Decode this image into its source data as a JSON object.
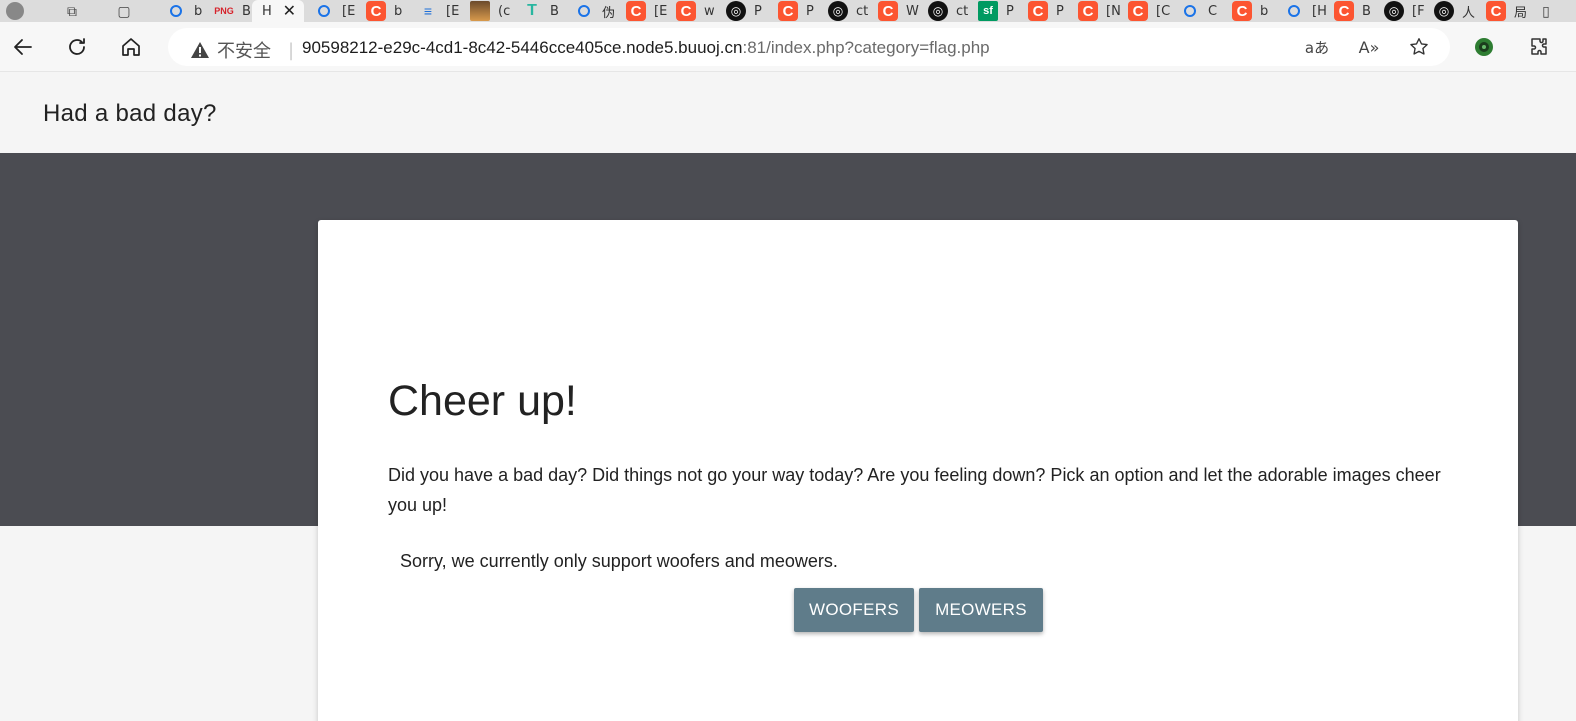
{
  "browser": {
    "tabs": [
      {
        "label": "bu",
        "icon": "search-icon"
      },
      {
        "label": "B",
        "icon": "page-icon"
      },
      {
        "label": "H",
        "icon": "page-icon",
        "active": true
      },
      {
        "label": "[E",
        "icon": "search-icon"
      },
      {
        "label": "b",
        "icon": "csdn-icon"
      },
      {
        "label": "[E",
        "icon": "layers-icon"
      },
      {
        "label": "(c",
        "icon": "image-icon"
      },
      {
        "label": "B",
        "icon": "t-icon"
      },
      {
        "label": "伪",
        "icon": "search-icon"
      },
      {
        "label": "[E",
        "icon": "csdn-icon"
      },
      {
        "label": "w",
        "icon": "csdn-icon"
      },
      {
        "label": "P",
        "icon": "spiral-icon"
      },
      {
        "label": "P",
        "icon": "csdn-icon"
      },
      {
        "label": "ct",
        "icon": "spiral-icon"
      },
      {
        "label": "W",
        "icon": "csdn-icon"
      },
      {
        "label": "ct",
        "icon": "spiral-icon"
      },
      {
        "label": "P",
        "icon": "sf-icon"
      },
      {
        "label": "P",
        "icon": "csdn-icon"
      },
      {
        "label": "[N",
        "icon": "csdn-icon"
      },
      {
        "label": "[C",
        "icon": "csdn-icon"
      },
      {
        "label": "C",
        "icon": "search-icon"
      },
      {
        "label": "b",
        "icon": "csdn-icon"
      },
      {
        "label": "[H",
        "icon": "search-icon"
      },
      {
        "label": "B",
        "icon": "csdn-icon"
      },
      {
        "label": "[F",
        "icon": "spiral-icon"
      },
      {
        "label": "人",
        "icon": "spiral-icon"
      },
      {
        "label": "局",
        "icon": "csdn-icon"
      }
    ],
    "close_tab_glyph": "✕",
    "security_label": "不安全",
    "url_host": "90598212-e29c-4cd1-8c42-5446cce405ce.node5.buuoj.cn",
    "url_rest": ":81/index.php?category=flag.php",
    "translate_glyph": "aあ",
    "read_aloud_glyph": "A»"
  },
  "page": {
    "site_title": "Had a bad day?",
    "heading": "Cheer up!",
    "body": "Did you have a bad day? Did things not go your way today? Are you feeling down? Pick an option and let the adorable images cheer you up!",
    "note": "Sorry, we currently only support woofers and meowers.",
    "buttons": {
      "woofers": "WOOFERS",
      "meowers": "MEOWERS"
    }
  },
  "colors": {
    "hero": "#4b4c52",
    "button": "#5f7c8a",
    "csdn": "#fc5531"
  }
}
